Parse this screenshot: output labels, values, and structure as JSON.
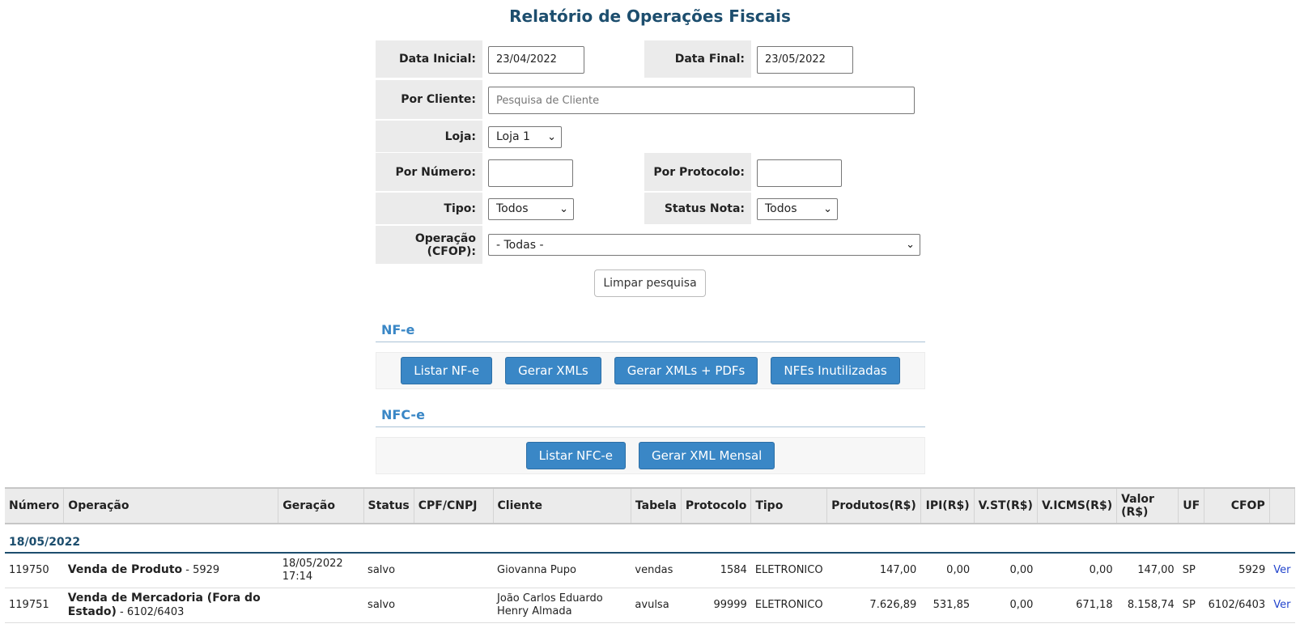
{
  "page": {
    "title": "Relatório de Operações Fiscais"
  },
  "filters": {
    "data_inicial_label": "Data Inicial:",
    "data_inicial_value": "23/04/2022",
    "data_final_label": "Data Final:",
    "data_final_value": "23/05/2022",
    "cliente_label": "Por Cliente:",
    "cliente_placeholder": "Pesquisa de Cliente",
    "loja_label": "Loja:",
    "loja_value": "Loja 1",
    "numero_label": "Por Número:",
    "protocolo_label": "Por Protocolo:",
    "tipo_label": "Tipo:",
    "tipo_value": "Todos",
    "status_label": "Status Nota:",
    "status_value": "Todos",
    "operacao_label_1": "Operação",
    "operacao_label_2": "(CFOP):",
    "operacao_value": "- Todas -",
    "clear_label": "Limpar pesquisa"
  },
  "nfe": {
    "title": "NF-e",
    "buttons": [
      "Listar NF-e",
      "Gerar XMLs",
      "Gerar XMLs + PDFs",
      "NFEs Inutilizadas"
    ]
  },
  "nfce": {
    "title": "NFC-e",
    "buttons": [
      "Listar NFC-e",
      "Gerar XML Mensal"
    ]
  },
  "table": {
    "headers": {
      "numero": "Número",
      "operacao": "Operação",
      "geracao": "Geração",
      "status": "Status",
      "cpf": "CPF/CNPJ",
      "cliente": "Cliente",
      "tabela": "Tabela",
      "protocolo": "Protocolo",
      "tipo": "Tipo",
      "produtos": "Produtos(R$)",
      "ipi": "IPI(R$)",
      "vst": "V.ST(R$)",
      "vicms": "V.ICMS(R$)",
      "valor_1": "Valor",
      "valor_2": "(R$)",
      "uf": "UF",
      "cfop": "CFOP"
    },
    "group_date": "18/05/2022",
    "rows": [
      {
        "numero": "119750",
        "op_name": "Venda de Produto",
        "op_code": " - 5929",
        "geracao_date": "18/05/2022",
        "geracao_time": "17:14",
        "status": "salvo",
        "cpf": "",
        "cliente": "Giovanna Pupo",
        "tabela": "vendas",
        "protocolo": "1584",
        "tipo": "ELETRONICO",
        "produtos": "147,00",
        "ipi": "0,00",
        "vst": "0,00",
        "vicms": "0,00",
        "valor": "147,00",
        "uf": "SP",
        "cfop": "5929",
        "action": "Ver"
      },
      {
        "numero": "119751",
        "op_name": "Venda de Mercadoria (Fora do Estado)",
        "op_code": " - 6102/6403",
        "geracao_date": "",
        "geracao_time": "",
        "status": "salvo",
        "cpf": "",
        "cliente": "João Carlos Eduardo Henry Almada",
        "tabela": "avulsa",
        "protocolo": "99999",
        "tipo": "ELETRONICO",
        "produtos": "7.626,89",
        "ipi": "531,85",
        "vst": "0,00",
        "vicms": "671,18",
        "valor": "8.158,74",
        "uf": "SP",
        "cfop": "6102/6403",
        "action": "Ver"
      }
    ]
  }
}
